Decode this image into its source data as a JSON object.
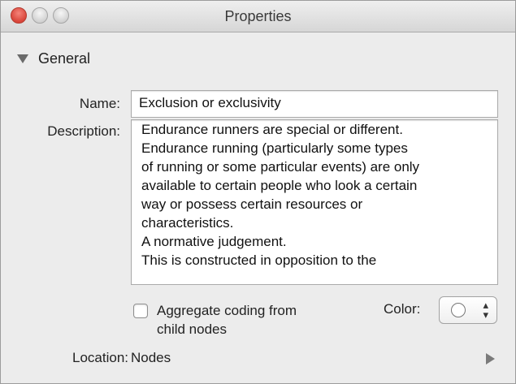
{
  "window": {
    "title": "Properties"
  },
  "section": {
    "title": "General"
  },
  "fields": {
    "name_label": "Name:",
    "name_value": "Exclusion or exclusivity",
    "description_label": "Description:",
    "description_lines": [
      "Endurance runners are special or different.",
      "Endurance running (particularly some types",
      "of running or some particular events) are only",
      "available to certain people who look a certain",
      "way or possess certain resources or",
      "characteristics.",
      "A normative judgement.",
      "This is constructed in opposition to the"
    ],
    "aggregate_label_line1": "Aggregate coding from",
    "aggregate_label_line2": "child nodes",
    "aggregate_checked": false,
    "color_label": "Color:",
    "color_value_icon": "empty-circle",
    "updown_icon": "⌃⌄",
    "location_label": "Location:",
    "location_value": "Nodes"
  }
}
